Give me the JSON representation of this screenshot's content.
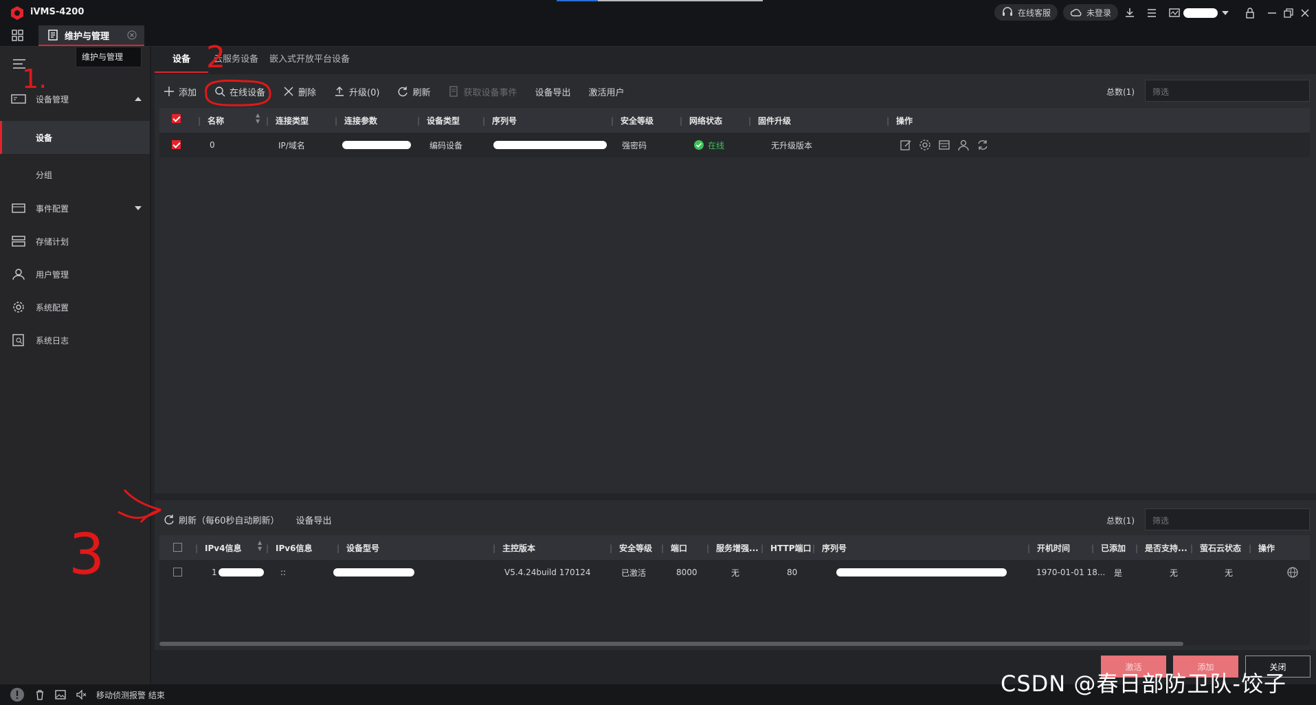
{
  "app": {
    "title": "iVMS-4200"
  },
  "titlebar": {
    "support": "在线客服",
    "cloud": "未登录"
  },
  "tab": {
    "label": "维护与管理",
    "tooltip": "维护与管理"
  },
  "sidebar": {
    "items": [
      {
        "label": "设备管理",
        "icon": "device-manage-icon"
      },
      {
        "label": "设备"
      },
      {
        "label": "分组"
      },
      {
        "label": "事件配置",
        "icon": "event-config-icon"
      },
      {
        "label": "存储计划",
        "icon": "storage-icon"
      },
      {
        "label": "用户管理",
        "icon": "user-icon"
      },
      {
        "label": "系统配置",
        "icon": "gear-icon"
      },
      {
        "label": "系统日志",
        "icon": "log-icon"
      }
    ]
  },
  "subtabs": [
    "设备",
    "云服务设备",
    "嵌入式开放平台设备"
  ],
  "toolbar": {
    "add": "添加",
    "online": "在线设备",
    "delete": "删除",
    "upgrade": "升级(0)",
    "refresh": "刷新",
    "events": "获取设备事件",
    "export": "设备导出",
    "activate_user": "激活用户",
    "total": "总数(1)",
    "filter_placeholder": "筛选"
  },
  "device_table": {
    "headers": [
      "名称",
      "连接类型",
      "连接参数",
      "设备类型",
      "序列号",
      "安全等级",
      "网络状态",
      "固件升级",
      "操作"
    ],
    "rows": [
      {
        "name": "0",
        "conn_type": "IP/域名",
        "dev_type": "编码设备",
        "security": "强密码",
        "status": "在线",
        "firmware": "无升级版本"
      }
    ]
  },
  "online_panel": {
    "refresh": "刷新（每60秒自动刷新）",
    "export": "设备导出",
    "total": "总数(1)",
    "filter_placeholder": "筛选",
    "headers": [
      "IPv4信息",
      "IPv6信息",
      "设备型号",
      "主控版本",
      "安全等级",
      "端口",
      "服务增强...",
      "HTTP端口",
      "序列号",
      "开机时间",
      "已添加",
      "是否支持...",
      "萤石云状态",
      "操作"
    ],
    "rows": [
      {
        "ipv4": "1",
        "ipv6": "::",
        "version": "V5.4.24build 170124",
        "security": "已激活",
        "port": "8000",
        "enhance": "无",
        "http": "80",
        "boot": "1970-01-01 18...",
        "added": "是",
        "support": "无",
        "ezviz": "无"
      }
    ]
  },
  "buttons": {
    "activate": "激活",
    "add": "添加",
    "close": "关闭"
  },
  "statusbar": {
    "message": "移动侦测报警 结束"
  },
  "annotations": {
    "one": "1.",
    "two": "2",
    "three": "3"
  },
  "watermark": "CSDN @春日部防卫队-饺子",
  "colors": {
    "accent": "#e5232b",
    "online": "#3ec15a",
    "button_primary": "#e87379",
    "annotation": "#e01818"
  }
}
